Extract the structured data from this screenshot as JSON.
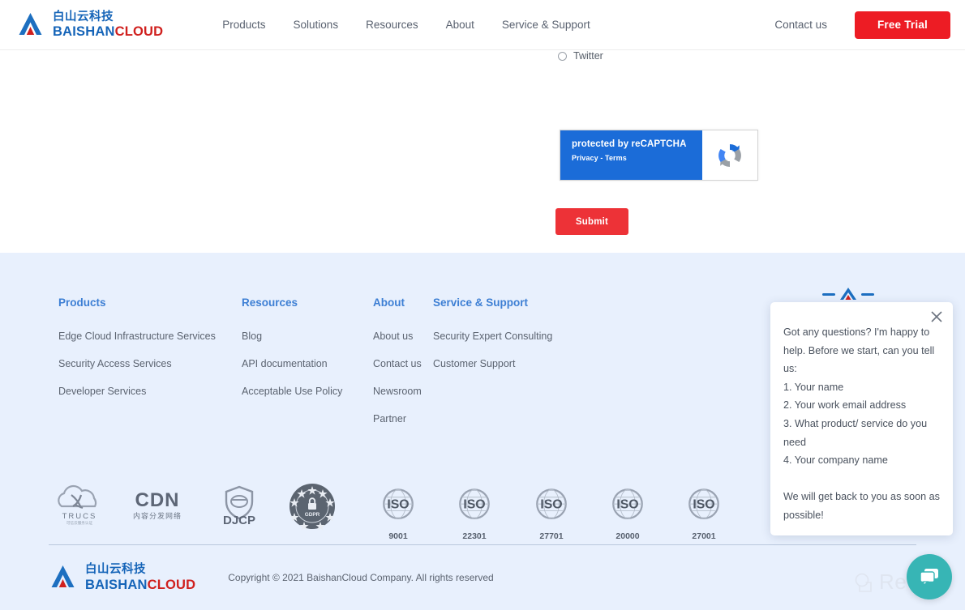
{
  "header": {
    "logo": {
      "cn": "白山云科技",
      "en_blue": "BAISHAN",
      "en_red": "CLOUD",
      "icon": "baishan-a-logo"
    },
    "nav": [
      {
        "label": "Products"
      },
      {
        "label": "Solutions"
      },
      {
        "label": "Resources"
      },
      {
        "label": "About"
      },
      {
        "label": "Service & Support"
      }
    ],
    "contact_label": "Contact us",
    "free_trial_label": "Free Trial"
  },
  "main": {
    "radio_twitter_label": "Twitter",
    "recaptcha": {
      "title": "protected by reCAPTCHA",
      "subtitle": "Privacy - Terms",
      "icon": "recaptcha-icon"
    },
    "submit_label": "Submit"
  },
  "footer": {
    "columns": [
      {
        "title": "Products",
        "links": [
          "Edge Cloud Infrastructure Services",
          "Security Access Services",
          "Developer Services"
        ]
      },
      {
        "title": "Resources",
        "links": [
          "Blog",
          "API documentation",
          "Acceptable Use Policy"
        ]
      },
      {
        "title": "About",
        "links": [
          "About us",
          "Contact us",
          "Newsroom",
          "Partner"
        ]
      },
      {
        "title": "Service & Support",
        "links": [
          "Security Expert Consulting",
          "Customer Support"
        ]
      }
    ],
    "badges": [
      {
        "name": "trucs-badge",
        "caption": "",
        "label": "TRUCS",
        "sub": "可信云服务认证"
      },
      {
        "name": "cdn-badge",
        "caption": "",
        "label": "CDN",
        "sub": "内容分发网络"
      },
      {
        "name": "djcp-badge",
        "caption": "",
        "label": "DJCP",
        "sub": ""
      },
      {
        "name": "gdpr-badge",
        "caption": "",
        "label": "GDPR",
        "sub": ""
      },
      {
        "name": "iso-badge",
        "caption": "9001",
        "label": "ISO",
        "sub": ""
      },
      {
        "name": "iso-badge",
        "caption": "22301",
        "label": "ISO",
        "sub": ""
      },
      {
        "name": "iso-badge",
        "caption": "27701",
        "label": "ISO",
        "sub": ""
      },
      {
        "name": "iso-badge",
        "caption": "20000",
        "label": "ISO",
        "sub": ""
      },
      {
        "name": "iso-badge",
        "caption": "27001",
        "label": "ISO",
        "sub": ""
      }
    ],
    "copyright": "Copyright © 2021 BaishanCloud Company. All rights reserved"
  },
  "chat": {
    "close_icon": "close-icon",
    "message": "Got any questions? I'm happy to help. Before we start, can you tell us:\n1. Your name\n2. Your work email address\n3. What product/ service do you need\n4. Your company name\n\nWe will get back to you as soon as possible!",
    "fab_icon": "chat-bubble-icon",
    "fab_color": "#37b5b5"
  },
  "watermark": {
    "text": "Revain",
    "icon": "revain-icon"
  },
  "colors": {
    "brand_blue": "#1564b8",
    "brand_red": "#d0201e",
    "cta_red": "#ed1c24",
    "footer_bg": "#e8f0fd",
    "footer_heading": "#3d7fd4"
  }
}
